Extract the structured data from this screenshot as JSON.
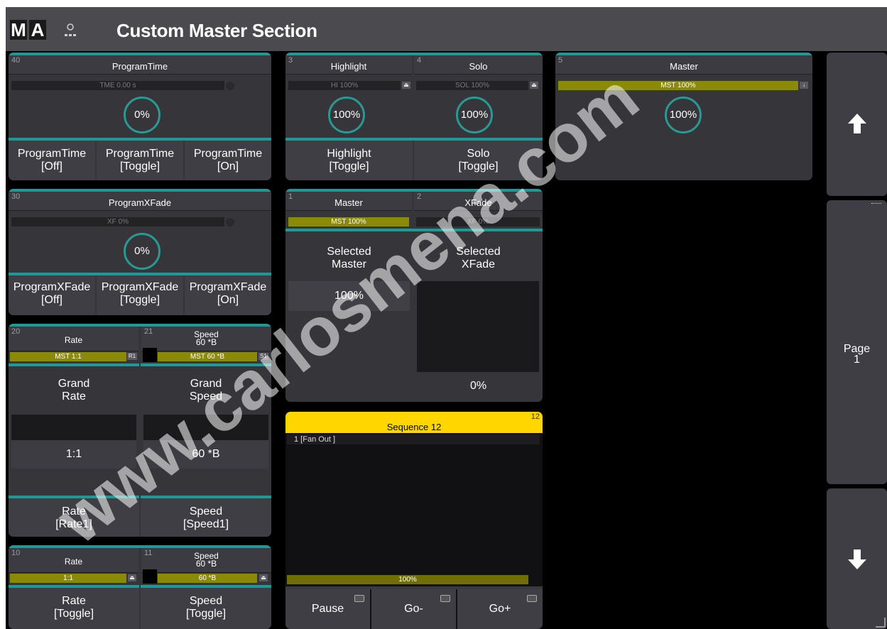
{
  "titlebar": {
    "logo_left": "M",
    "logo_right": "A",
    "title": "Custom Master Section",
    "user_icon": "user-icon"
  },
  "program_time": {
    "number": "40",
    "label": "ProgramTime",
    "bar": "TME 0.00 s",
    "dial": "0%",
    "buttons": [
      {
        "line1": "ProgramTime",
        "line2": "[Off]"
      },
      {
        "line1": "ProgramTime",
        "line2": "[Toggle]"
      },
      {
        "line1": "ProgramTime",
        "line2": "[On]"
      }
    ]
  },
  "program_xfade": {
    "number": "30",
    "label": "ProgramXFade",
    "bar": "XF 0%",
    "dial": "0%",
    "buttons": [
      {
        "line1": "ProgramXFade",
        "line2": "[Off]"
      },
      {
        "line1": "ProgramXFade",
        "line2": "[Toggle]"
      },
      {
        "line1": "ProgramXFade",
        "line2": "[On]"
      }
    ]
  },
  "highlight": {
    "number": "3",
    "label": "Highlight",
    "bar": "HI 100%",
    "dial": "100%",
    "button_line1": "Highlight",
    "button_line2": "[Toggle]"
  },
  "solo": {
    "number": "4",
    "label": "Solo",
    "bar": "SOL 100%",
    "dial": "100%",
    "button_line1": "Solo",
    "button_line2": "[Toggle]"
  },
  "master5": {
    "number": "5",
    "label": "Master",
    "bar": "MST 100%",
    "dial": "100%"
  },
  "master1": {
    "number": "1",
    "label": "Master",
    "bar": "MST 100%",
    "title_line1": "Selected",
    "title_line2": "Master",
    "value": "100%"
  },
  "xfade2": {
    "number": "2",
    "label": "XFade",
    "bar": "XF 0%",
    "title_line1": "Selected",
    "title_line2": "XFade",
    "value": "0%"
  },
  "rate20": {
    "number": "20",
    "label": "Rate",
    "bar": "MST 1:1",
    "tag": "R1",
    "title_line1": "Grand",
    "title_line2": "Rate",
    "value": "1:1",
    "button_line1": "Rate",
    "button_line2": "[Rate1]"
  },
  "speed21": {
    "number": "21",
    "label": "Speed",
    "sublabel": "60 *B",
    "bar": "MST 60 *B",
    "tag": "S1",
    "title_line1": "Grand",
    "title_line2": "Speed",
    "value": "60 *B",
    "button_line1": "Speed",
    "button_line2": "[Speed1]"
  },
  "rate10": {
    "number": "10",
    "label": "Rate",
    "bar": "1:1",
    "button_line1": "Rate",
    "button_line2": "[Toggle]"
  },
  "speed11": {
    "number": "11",
    "label": "Speed",
    "sublabel": "60 *B",
    "bar": "60 *B",
    "button_line1": "Speed",
    "button_line2": "[Toggle]"
  },
  "sequence": {
    "number": "12",
    "title": "Sequence 12",
    "cue": "1 [Fan Out ]",
    "bar": "100%",
    "buttons": [
      "Pause",
      "Go-",
      "Go+"
    ]
  },
  "rail": {
    "up_icon": "arrow-up-icon",
    "page_line1": "Page",
    "page_line2": "1",
    "down_icon": "arrow-down-icon"
  },
  "watermark": "www.carlosmena.com",
  "colors": {
    "teal": "#1e9a96",
    "olive": "#8a8a07",
    "sequence_yellow": "#ffd600",
    "background": "#000000"
  }
}
